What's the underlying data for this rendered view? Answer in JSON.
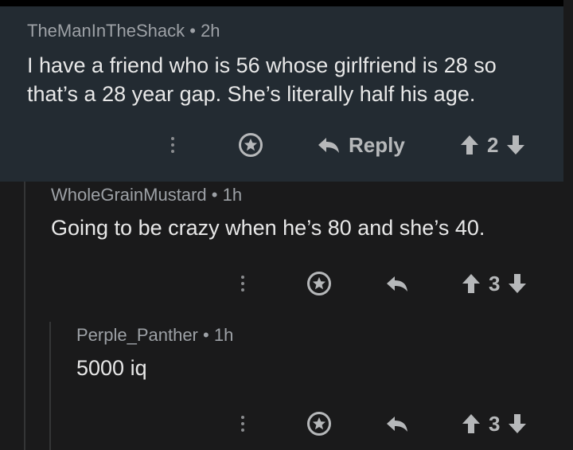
{
  "comments": [
    {
      "author": "TheManInTheShack",
      "age": "2h",
      "body_line1": "I have a friend who is 56 whose girlfriend is 28 so",
      "body_line2": "that’s a 28 year gap. She’s literally half his age.",
      "reply_label": "Reply",
      "score": "2"
    },
    {
      "author": "WholeGrainMustard",
      "age": "1h",
      "body_line1": "Going to be crazy when he’s 80 and she’s 40.",
      "score": "3"
    },
    {
      "author": "Perple_Panther",
      "age": "1h",
      "body_line1": "5000 iq",
      "score": "3"
    }
  ],
  "separator": "•",
  "colors": {
    "background": "#1a1a1b",
    "highlight_background": "#232b32",
    "icon": "#b6b8ba"
  },
  "icons": [
    "more-icon",
    "award-icon",
    "reply-icon",
    "upvote-icon",
    "downvote-icon"
  ]
}
